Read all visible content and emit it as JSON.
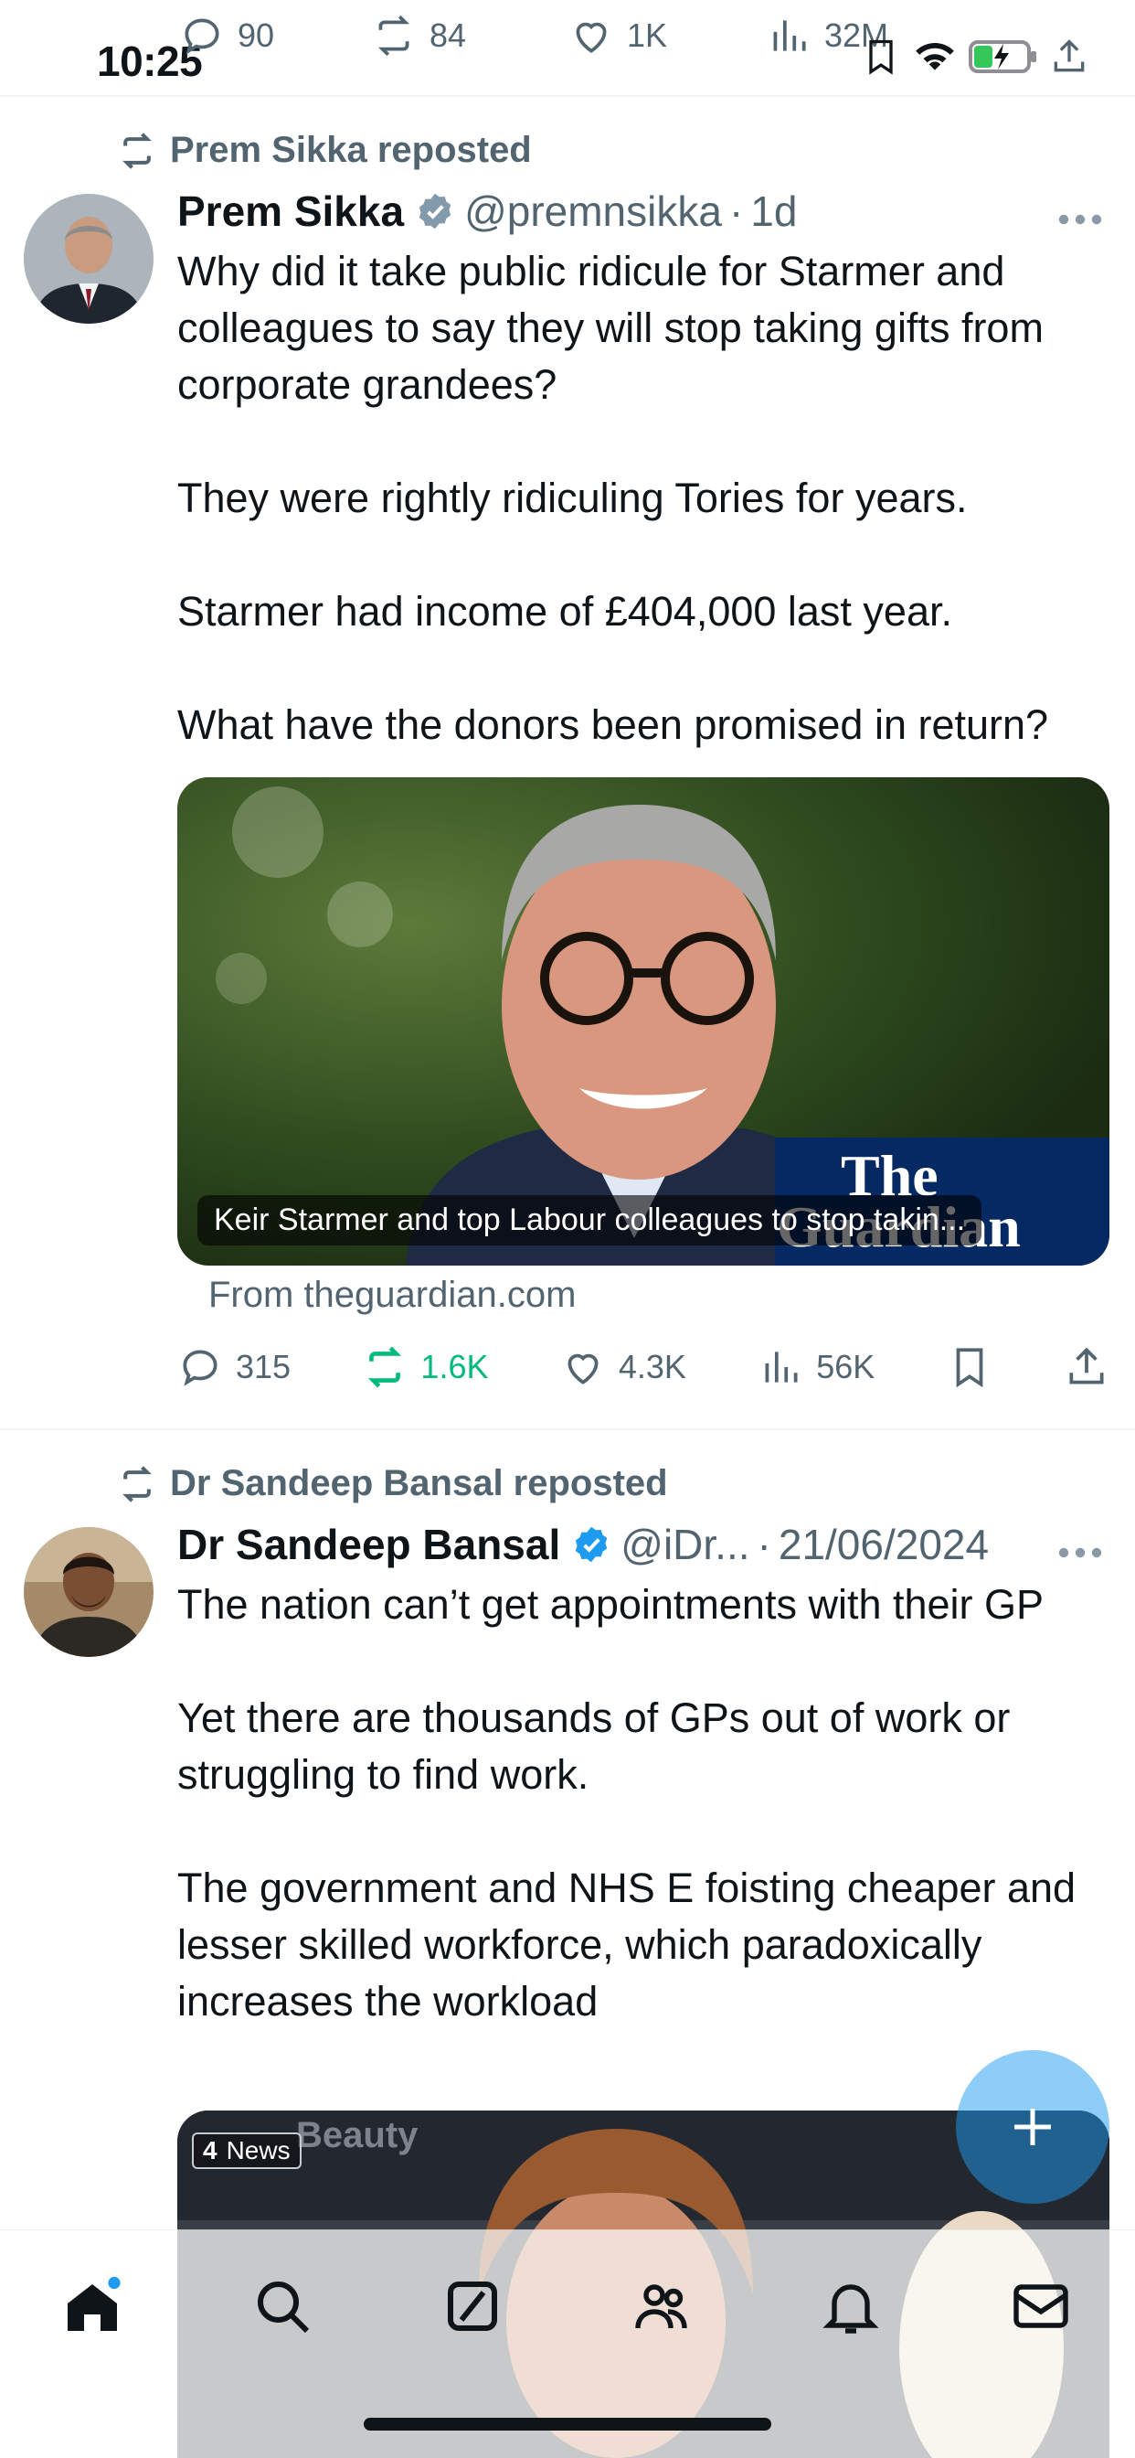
{
  "status_bar": {
    "time": "10:25"
  },
  "top_actions": {
    "replies": "90",
    "reposts": "84",
    "likes": "1K",
    "views": "32M"
  },
  "tweets": [
    {
      "repost_label": "Prem Sikka reposted",
      "name": "Prem Sikka",
      "handle": "@premnsikka",
      "dot": "·",
      "time": "1d",
      "paragraphs": [
        "Why did it take public ridicule for Starmer and colleagues to say they will stop taking gifts from corporate grandees?",
        "They were rightly ridiculing Tories for years.",
        "Starmer had income of £404,000 last year.",
        "What have the donors been promised in return?"
      ],
      "card": {
        "caption": "Keir Starmer and top Labour colleagues to stop takin...",
        "logo_line1": "The",
        "logo_line2": "Guardian",
        "source": "From theguardian.com"
      },
      "actions": {
        "replies": "315",
        "reposts": "1.6K",
        "likes": "4.3K",
        "views": "56K"
      }
    },
    {
      "repost_label": "Dr Sandeep Bansal reposted",
      "name": "Dr Sandeep Bansal",
      "handle": "@iDr...",
      "dot": "·",
      "time": "21/06/2024",
      "paragraphs": [
        "The nation can’t get appointments with their GP",
        "Yet there are thousands of GPs out of work or struggling to find work.",
        "The government and NHS E foisting cheaper and lesser skilled workforce, which paradoxically increases the workload"
      ],
      "media": {
        "badge": "News",
        "sign_text": "Beauty"
      }
    }
  ],
  "colors": {
    "accent": "#1d9bf0",
    "repost_green": "#00ba7c",
    "muted": "#536471"
  }
}
